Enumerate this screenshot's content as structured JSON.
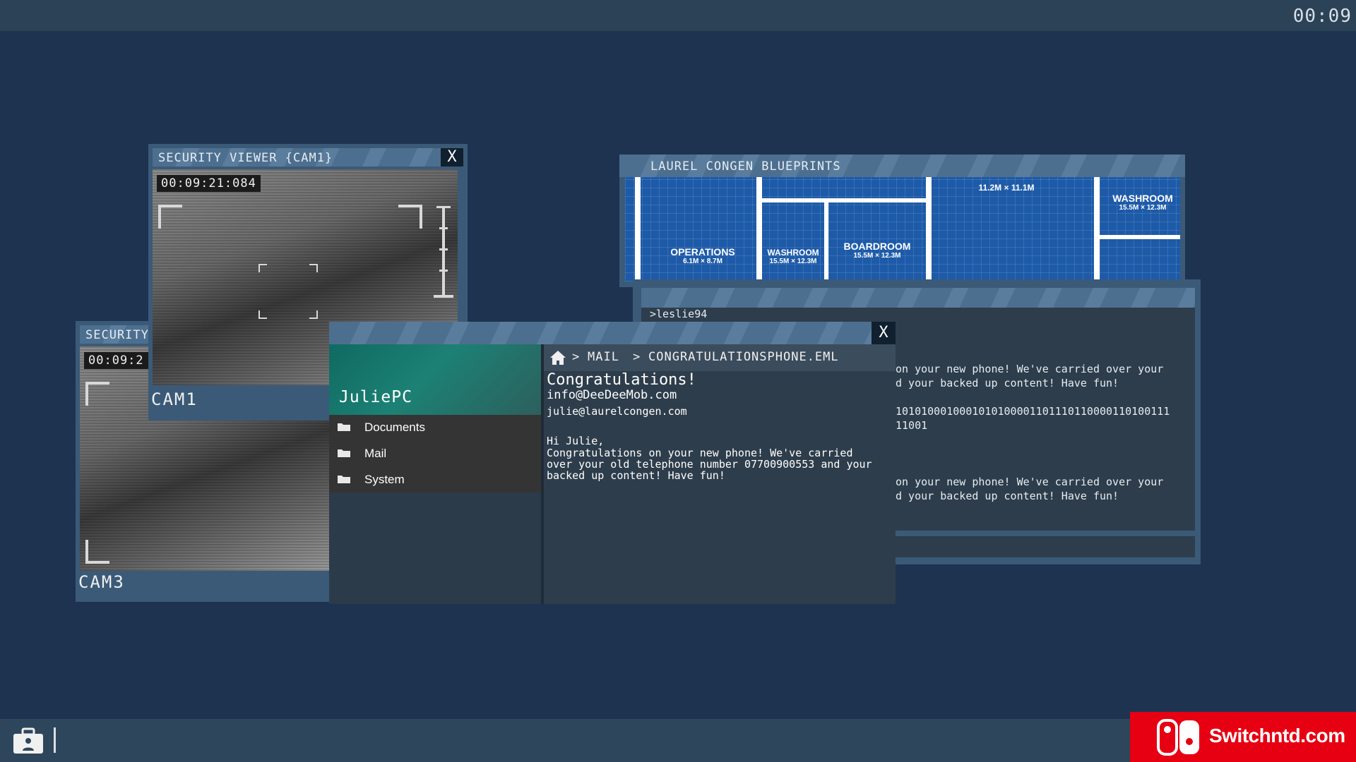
{
  "topbar": {
    "clock": "00:09"
  },
  "cam1": {
    "title": "SECURITY VIEWER {CAM1}",
    "close": "X",
    "timestamp": "00:09:21:084",
    "label": "CAM1"
  },
  "cam3": {
    "title": "SECURITY",
    "timestamp": "00:09:2",
    "label": "CAM3"
  },
  "blueprints": {
    "title": "LAUREL CONGEN BLUEPRINTS",
    "rooms": [
      {
        "name": "OPERATIONS",
        "dims": "6.1M × 8.7M"
      },
      {
        "name": "WASHROOM",
        "dims": "15.5M × 12.3M"
      },
      {
        "name": "BOARDROOM",
        "dims": "15.5M × 12.3M"
      },
      {
        "name": "WASHROOM",
        "dims": "15.5M × 12.3M"
      }
    ],
    "top_dims": "11.2M × 11.1M"
  },
  "terminal": {
    "prompt": ">leslie94",
    "lines": [
      "on your new phone! We've carried over your",
      "d your backed up content! Have fun!",
      "1010100010001010100001101110110000110100111",
      "11001",
      "on your new phone! We've carried over your",
      "d your backed up content! Have fun!"
    ]
  },
  "julie": {
    "close": "X",
    "pc_name": "JuliePC",
    "menu": [
      "Documents",
      "Mail",
      "System"
    ],
    "breadcrumb": {
      "sep": ">",
      "mail": "MAIL",
      "file": "CONGRATULATIONSPHONE.EML"
    },
    "mail": {
      "subject": "Congratulations!",
      "from": "info@DeeDeeMob.com",
      "to": "julie@laurelcongen.com",
      "greeting": "Hi Julie,",
      "body": [
        "Congratulations on your new phone! We've carried",
        "over your old telephone number 07700900553 and your",
        "backed up content! Have fun!"
      ]
    }
  },
  "brand": {
    "text": "Switchntd.com"
  },
  "colors": {
    "background": "#1e3350",
    "brand": "#e60012",
    "window": "#3b5a78"
  }
}
